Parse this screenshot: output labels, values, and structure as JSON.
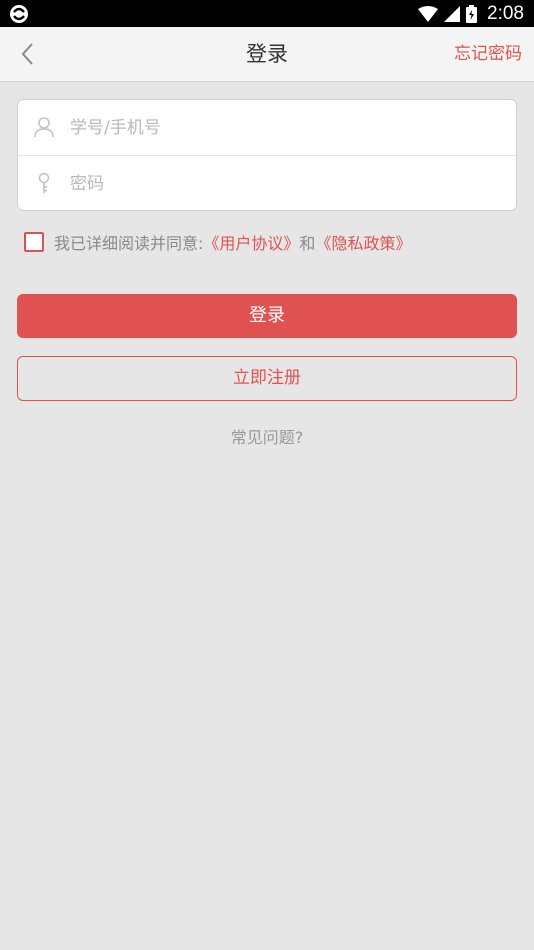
{
  "status_bar": {
    "time": "2:08"
  },
  "header": {
    "title": "登录",
    "forgot_password": "忘记密码"
  },
  "form": {
    "username_placeholder": "学号/手机号",
    "password_placeholder": "密码"
  },
  "agreement": {
    "prefix": "我已详细阅读并同意:",
    "user_agreement": "《用户协议》",
    "conjunction": "和",
    "privacy_policy": "《隐私政策》",
    "checked": false
  },
  "buttons": {
    "login": "登录",
    "register": "立即注册"
  },
  "faq": "常见问题?",
  "colors": {
    "accent": "#e05252",
    "background": "#e6e6e6",
    "header_bg": "#f4f4f4"
  },
  "icons": {
    "app_status": "sync-logo-icon",
    "wifi": "wifi-icon",
    "signal": "cellular-signal-icon",
    "battery": "battery-icon",
    "back": "chevron-left-icon",
    "user": "user-icon",
    "key": "key-icon"
  }
}
